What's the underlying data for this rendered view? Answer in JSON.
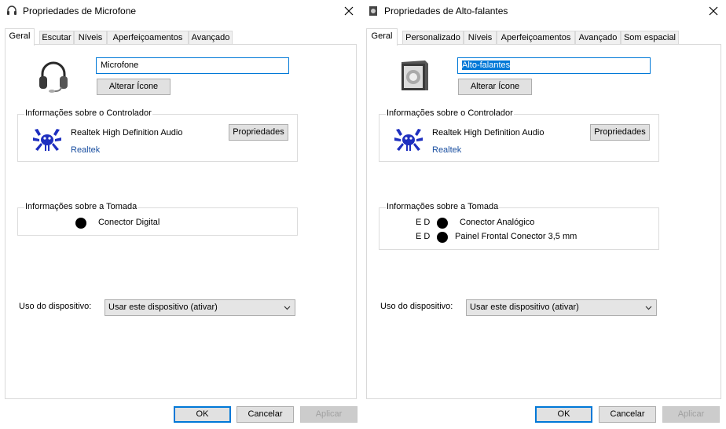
{
  "left": {
    "title": "Propriedades de Microfone",
    "tabs": [
      "Geral",
      "Escutar",
      "Níveis",
      "Aperfeiçoamentos",
      "Avançado"
    ],
    "device_name": "Microfone",
    "change_icon_label": "Alterar Ícone",
    "controller": {
      "group_label": "Informações sobre o Controlador",
      "name": "Realtek High Definition Audio",
      "vendor": "Realtek",
      "properties_label": "Propriedades"
    },
    "jack": {
      "group_label": "Informações sobre a Tomada",
      "connectors": [
        {
          "channels": "",
          "label": "Conector Digital"
        }
      ]
    },
    "usage_label": "Uso do dispositivo:",
    "usage_value": "Usar este dispositivo (ativar)",
    "ok_label": "OK",
    "cancel_label": "Cancelar",
    "apply_label": "Aplicar"
  },
  "right": {
    "title": "Propriedades de Alto-falantes",
    "tabs": [
      "Geral",
      "Personalizado",
      "Níveis",
      "Aperfeiçoamentos",
      "Avançado",
      "Som espacial"
    ],
    "device_name": "Alto-falantes",
    "change_icon_label": "Alterar Ícone",
    "controller": {
      "group_label": "Informações sobre o Controlador",
      "name": "Realtek High Definition Audio",
      "vendor": "Realtek",
      "properties_label": "Propriedades"
    },
    "jack": {
      "group_label": "Informações sobre a Tomada",
      "connectors": [
        {
          "channels": "E D",
          "label": "Conector Analógico"
        },
        {
          "channels": "E D",
          "label": "Painel Frontal Conector 3,5 mm"
        }
      ]
    },
    "usage_label": "Uso do dispositivo:",
    "usage_value": "Usar este dispositivo (ativar)",
    "ok_label": "OK",
    "cancel_label": "Cancelar",
    "apply_label": "Aplicar"
  },
  "colors": {
    "accent": "#0078d7",
    "link": "#1a4fa0",
    "disabled_text": "#a0a0a0"
  },
  "icons": [
    "headset-icon",
    "speaker-icon",
    "realtek-crab-icon",
    "close-icon",
    "chevron-down-icon"
  ]
}
